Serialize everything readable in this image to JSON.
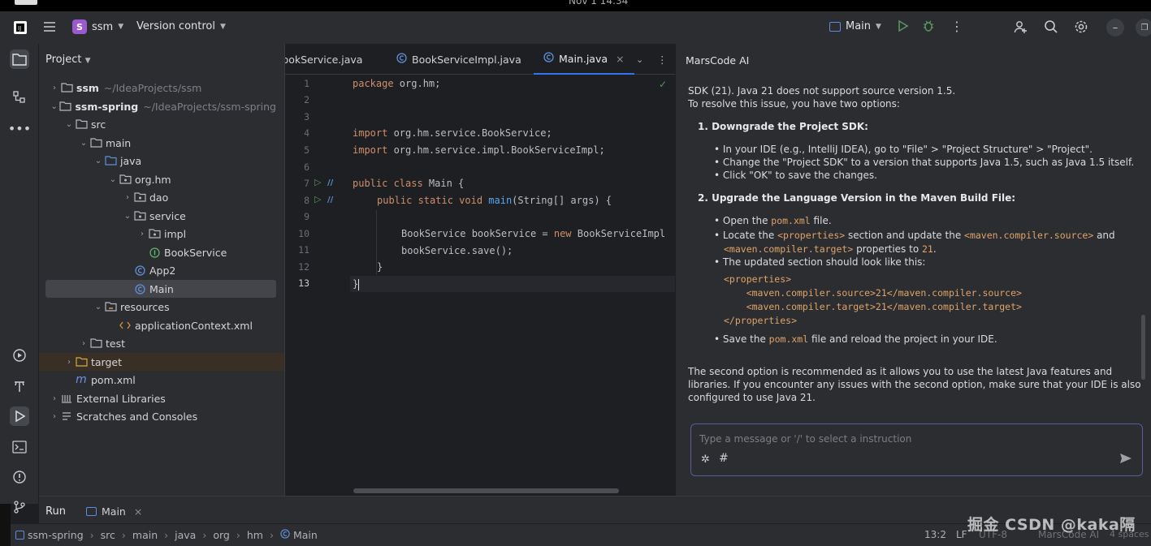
{
  "system": {
    "clock": "Nov 1  14:34"
  },
  "titlebar": {
    "project_letter": "S",
    "project_name": "ssm",
    "vcs_label": "Version control",
    "run_config": "Main",
    "colors": {
      "project_badge": "#9b59d0",
      "run_green": "#57965c"
    }
  },
  "project_panel": {
    "title": "Project",
    "tree": [
      {
        "label": "ssm",
        "path": "~/IdeaProjects/ssm",
        "bold": true
      },
      {
        "label": "ssm-spring",
        "path": "~/IdeaProjects/ssm-spring",
        "bold": true
      },
      {
        "label": "src"
      },
      {
        "label": "main"
      },
      {
        "label": "java"
      },
      {
        "label": "org.hm"
      },
      {
        "label": "dao"
      },
      {
        "label": "service"
      },
      {
        "label": "impl"
      },
      {
        "label": "BookService"
      },
      {
        "label": "App2"
      },
      {
        "label": "Main"
      },
      {
        "label": "resources"
      },
      {
        "label": "applicationContext.xml"
      },
      {
        "label": "test"
      },
      {
        "label": "target"
      },
      {
        "label": "pom.xml"
      },
      {
        "label": "External Libraries"
      },
      {
        "label": "Scratches and Consoles"
      }
    ]
  },
  "editor": {
    "tabs": [
      "BookService.java",
      "BookServiceImpl.java",
      "Main.java"
    ],
    "line_numbers": [
      "1",
      "2",
      "3",
      "4",
      "5",
      "6",
      "7",
      "8",
      "9",
      "10",
      "11",
      "12",
      "13"
    ],
    "code": {
      "l1_kw": "package",
      "l1_rest": " org.hm;",
      "l4_kw": "import",
      "l4_rest": " org.hm.service.BookService;",
      "l5_kw": "import",
      "l5_rest": " org.hm.service.impl.BookServiceImpl;",
      "l7_kw": "public class",
      "l7_rest": " Main {",
      "l8_kw": "public static void",
      "l8_fn": " main",
      "l8_rest": "(String[] args) {",
      "l10_pre": "BookService bookService = ",
      "l10_kw": "new",
      "l10_rest": " BookServiceImpl",
      "l11": "bookService.save();",
      "l12": "}",
      "l13": "}"
    }
  },
  "chat": {
    "title": "MarsCode AI",
    "p1": "SDK (21). Java 21 does not support source version 1.5.",
    "p2": "To resolve this issue, you have two options:",
    "opt1": "1. Downgrade the Project SDK:",
    "opt1_bullets": [
      "• In your IDE (e.g., IntelliJ IDEA), go to \"File\" > \"Project Structure\" > \"Project\".",
      "• Change the \"Project SDK\" to a version that supports Java 1.5, such as Java 1.5 itself.",
      "• Click \"OK\" to save the changes."
    ],
    "opt2": "2. Upgrade the Language Version in the Maven Build File:",
    "b_open_pre": "• Open the ",
    "b_open_code": "pom.xml",
    "b_open_post": " file.",
    "b_locate_pre": "• Locate the ",
    "b_locate_code": "<properties>",
    "b_locate_mid": " section and update the ",
    "b_locate_code2": "<maven.compiler.source>",
    "b_locate_post": " and",
    "b_locate2_code": "<maven.compiler.target>",
    "b_locate2_mid": " properties to ",
    "b_locate2_code2": "21",
    "b_locate2_post": ".",
    "b_updated": "• The updated section should look like this:",
    "xml": [
      "<properties>",
      "    <maven.compiler.source>21</maven.compiler.source>",
      "    <maven.compiler.target>21</maven.compiler.target>",
      "</properties>"
    ],
    "b_save_pre": "• Save the ",
    "b_save_code": "pom.xml",
    "b_save_post": " file and reload the project in your IDE.",
    "closing": [
      "The second option is recommended as it allows you to use the latest Java features and",
      "libraries. If you encounter any issues with the second option, make sure that your IDE is also",
      "configured to use Java 21."
    ],
    "input_placeholder": "Type a message or '/' to select a instruction"
  },
  "runbar": {
    "label": "Run",
    "tab": "Main"
  },
  "status": {
    "breadcrumb": [
      "ssm-spring",
      "src",
      "main",
      "java",
      "org",
      "hm",
      "Main"
    ],
    "position": "13:2",
    "line_sep": "LF",
    "encoding": "UTF-8",
    "plugin": "MarsCode AI",
    "indent": "4 spaces",
    "watermark": "掘金 CSDN @kaka隔"
  }
}
